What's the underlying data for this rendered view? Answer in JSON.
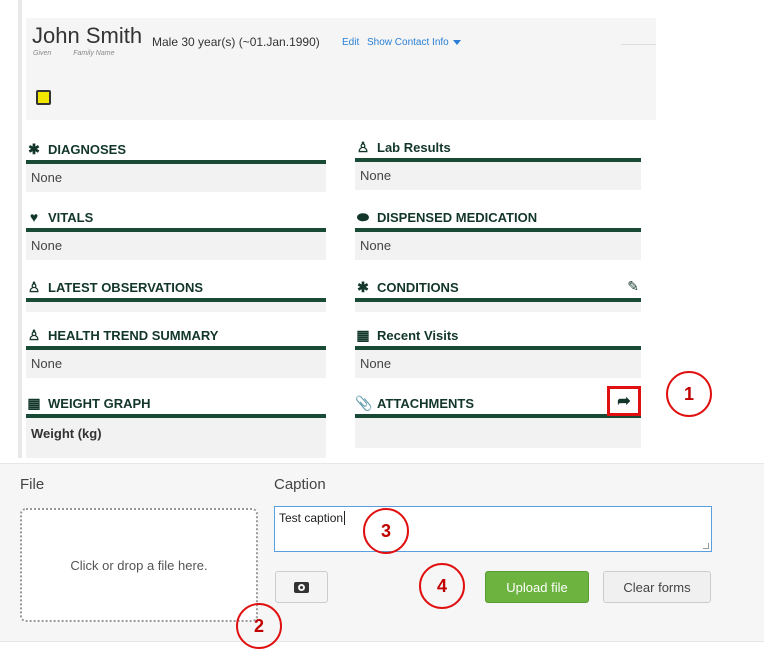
{
  "patient": {
    "given_label": "Given",
    "family_label": "Family Name",
    "name": "John Smith",
    "demographics": "Male  30 year(s) (~01.Jan.1990)",
    "edit_link": "Edit",
    "contact_link": "Show Contact Info"
  },
  "widgets": {
    "diagnoses": {
      "title": "DIAGNOSES",
      "value": "None",
      "icon": "person-icon"
    },
    "lab_results": {
      "title": "Lab Results",
      "value": "None",
      "icon": "doctor-icon"
    },
    "vitals": {
      "title": "VITALS",
      "value": "None",
      "icon": "heartbeat-icon"
    },
    "dispensed_medication": {
      "title": "DISPENSED MEDICATION",
      "value": "None",
      "icon": "pill-icon"
    },
    "latest_observations": {
      "title": "LATEST OBSERVATIONS",
      "value": "",
      "icon": "doctor-icon"
    },
    "conditions": {
      "title": "CONDITIONS",
      "value": "",
      "icon": "person-icon"
    },
    "health_trend_summary": {
      "title": "HEALTH TREND SUMMARY",
      "value": "None",
      "icon": "doctor-icon"
    },
    "recent_visits": {
      "title": "Recent Visits",
      "value": "None",
      "icon": "calendar-icon"
    },
    "weight_graph": {
      "title": "WEIGHT GRAPH",
      "value": "Weight (kg)",
      "icon": "bar-chart-icon"
    },
    "attachments": {
      "title": "ATTACHMENTS",
      "value": "",
      "icon": "paperclip-icon"
    }
  },
  "form": {
    "file_label": "File",
    "caption_label": "Caption",
    "dropzone_text": "Click or drop a file here.",
    "caption_value": "Test caption",
    "upload_button": "Upload file",
    "clear_button": "Clear forms"
  },
  "callouts": [
    "1",
    "2",
    "3",
    "4"
  ],
  "colors": {
    "accent_green": "#6cb33f",
    "widget_bar": "#184a36",
    "callout_red": "#e01010",
    "link_blue": "#2a7fd4"
  }
}
